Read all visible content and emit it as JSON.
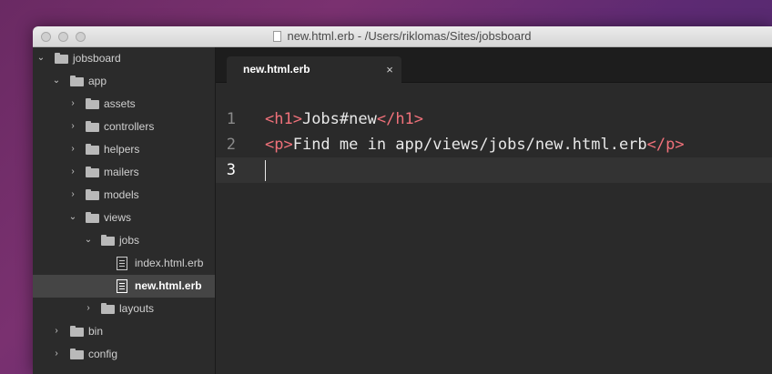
{
  "window": {
    "title": "new.html.erb - /Users/riklomas/Sites/jobsboard"
  },
  "sidebar": {
    "items": [
      {
        "label": "jobsboard",
        "kind": "folder",
        "expanded": true
      },
      {
        "label": "app",
        "kind": "folder",
        "expanded": true
      },
      {
        "label": "assets",
        "kind": "folder",
        "expanded": false
      },
      {
        "label": "controllers",
        "kind": "folder",
        "expanded": false
      },
      {
        "label": "helpers",
        "kind": "folder",
        "expanded": false
      },
      {
        "label": "mailers",
        "kind": "folder",
        "expanded": false
      },
      {
        "label": "models",
        "kind": "folder",
        "expanded": false
      },
      {
        "label": "views",
        "kind": "folder",
        "expanded": true
      },
      {
        "label": "jobs",
        "kind": "folder",
        "expanded": true
      },
      {
        "label": "index.html.erb",
        "kind": "file"
      },
      {
        "label": "new.html.erb",
        "kind": "file",
        "selected": true
      },
      {
        "label": "layouts",
        "kind": "folder",
        "expanded": false
      },
      {
        "label": "bin",
        "kind": "folder",
        "expanded": false
      },
      {
        "label": "config",
        "kind": "folder",
        "expanded": false
      }
    ]
  },
  "tabs": [
    {
      "label": "new.html.erb",
      "close": "×",
      "active": true
    }
  ],
  "editor": {
    "lines": [
      {
        "number": "1",
        "open_tag": "<h1>",
        "text": "Jobs#new",
        "close_tag": "</h1>"
      },
      {
        "number": "2",
        "open_tag": "<p>",
        "text": "Find me in app/views/jobs/new.html.erb",
        "close_tag": "</p>"
      },
      {
        "number": "3",
        "open_tag": "",
        "text": "",
        "close_tag": ""
      }
    ],
    "current_line": 3
  },
  "colors": {
    "editor_bg": "#2a2a2a",
    "tag": "#f0717a",
    "text": "#e8e8e8",
    "sidebar_bg": "#2b2b2b",
    "selection": "#454545"
  }
}
